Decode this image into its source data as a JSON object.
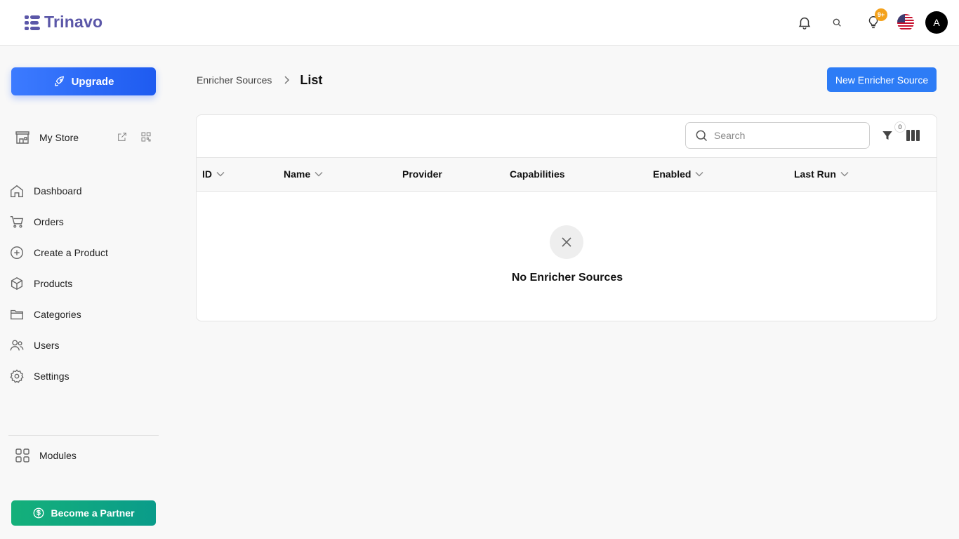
{
  "app": {
    "logo_text": "Trinavo"
  },
  "header": {
    "notification_badge": "9+",
    "avatar_initial": "A"
  },
  "sidebar": {
    "upgrade_label": "Upgrade",
    "store_label": "My Store",
    "items": [
      {
        "label": "Dashboard",
        "icon": "home-icon"
      },
      {
        "label": "Orders",
        "icon": "cart-icon"
      },
      {
        "label": "Create a Product",
        "icon": "plus-circle-icon"
      },
      {
        "label": "Products",
        "icon": "box-icon"
      },
      {
        "label": "Categories",
        "icon": "folder-icon"
      },
      {
        "label": "Users",
        "icon": "users-icon"
      },
      {
        "label": "Settings",
        "icon": "gear-icon"
      }
    ],
    "modules_label": "Modules",
    "partner_label": "Become a Partner"
  },
  "breadcrumb": {
    "parent": "Enricher Sources",
    "current": "List"
  },
  "actions": {
    "new_label": "New Enricher Source"
  },
  "table": {
    "search_placeholder": "Search",
    "filter_count": "0",
    "columns": [
      "ID",
      "Name",
      "Provider",
      "Capabilities",
      "Enabled",
      "Last Run"
    ],
    "empty_text": "No Enricher Sources"
  },
  "colors": {
    "brand": "#5b57a8",
    "primary": "#2d7cf6",
    "partner": "#14b07a",
    "badge": "#f4a21c"
  }
}
